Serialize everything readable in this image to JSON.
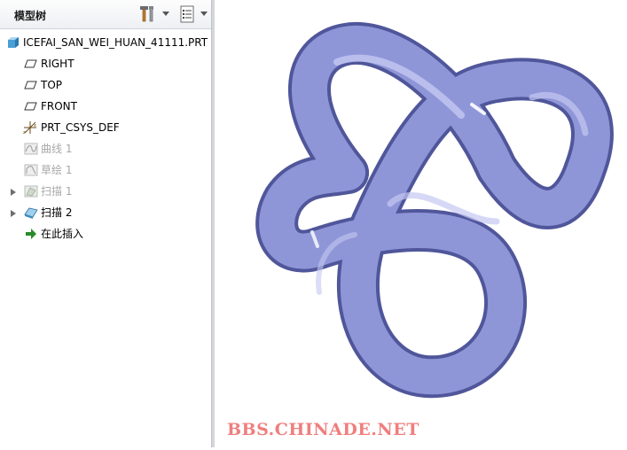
{
  "panel": {
    "title": "模型树",
    "settings_icon": "hammer-wrench-icon",
    "show_icon": "list-document-icon"
  },
  "tree": {
    "root": {
      "label": "ICEFAI_SAN_WEI_HUAN_41111.PRT",
      "icon": "part-icon"
    },
    "items": [
      {
        "label": "RIGHT",
        "icon": "datum-plane-icon",
        "dimmed": false
      },
      {
        "label": "TOP",
        "icon": "datum-plane-icon",
        "dimmed": false
      },
      {
        "label": "FRONT",
        "icon": "datum-plane-icon",
        "dimmed": false
      },
      {
        "label": "PRT_CSYS_DEF",
        "icon": "csys-icon",
        "dimmed": false
      },
      {
        "label": "曲线 1",
        "icon": "curve-icon",
        "dimmed": true
      },
      {
        "label": "草绘 1",
        "icon": "sketch-icon",
        "dimmed": true
      },
      {
        "label": "扫描 1",
        "icon": "sweep-icon",
        "dimmed": true
      },
      {
        "label": "扫描 2",
        "icon": "sweep-icon",
        "dimmed": false
      },
      {
        "label": "在此插入",
        "icon": "insert-arrow-icon",
        "dimmed": false
      }
    ]
  },
  "viewport": {
    "model": "trefoil-knot-tube",
    "model_color": "#8f96d8"
  },
  "watermark": "BBS.CHINADE.NET"
}
